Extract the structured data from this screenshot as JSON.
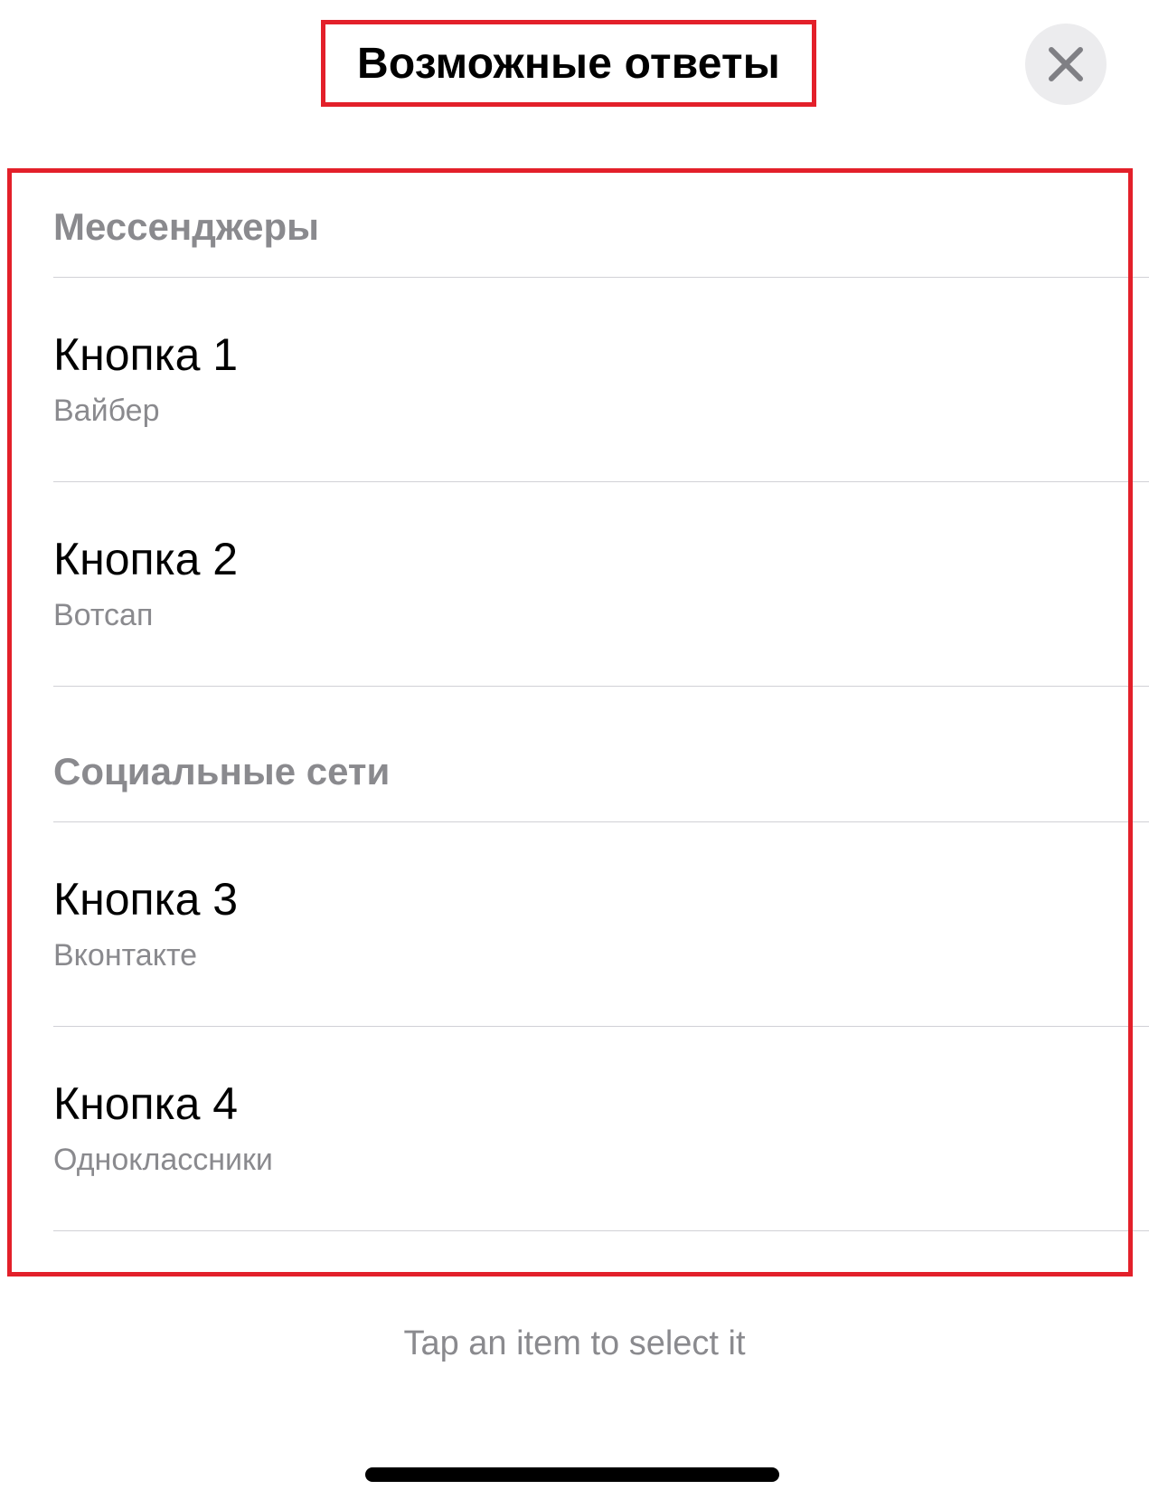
{
  "header": {
    "title": "Возможные ответы",
    "close_icon": "close-icon"
  },
  "sections": [
    {
      "title": "Мессенджеры",
      "items": [
        {
          "title": "Кнопка 1",
          "subtitle": "Вайбер"
        },
        {
          "title": "Кнопка 2",
          "subtitle": "Вотсап"
        }
      ]
    },
    {
      "title": "Социальные сети",
      "items": [
        {
          "title": "Кнопка 3",
          "subtitle": "Вконтакте"
        },
        {
          "title": "Кнопка 4",
          "subtitle": "Одноклассники"
        }
      ]
    }
  ],
  "footer": {
    "hint": "Tap an item to select it"
  },
  "colors": {
    "highlight": "#e3202a",
    "secondary_text": "#8a8a8e",
    "divider": "#d1d1d6",
    "close_button_bg": "#ececee"
  }
}
